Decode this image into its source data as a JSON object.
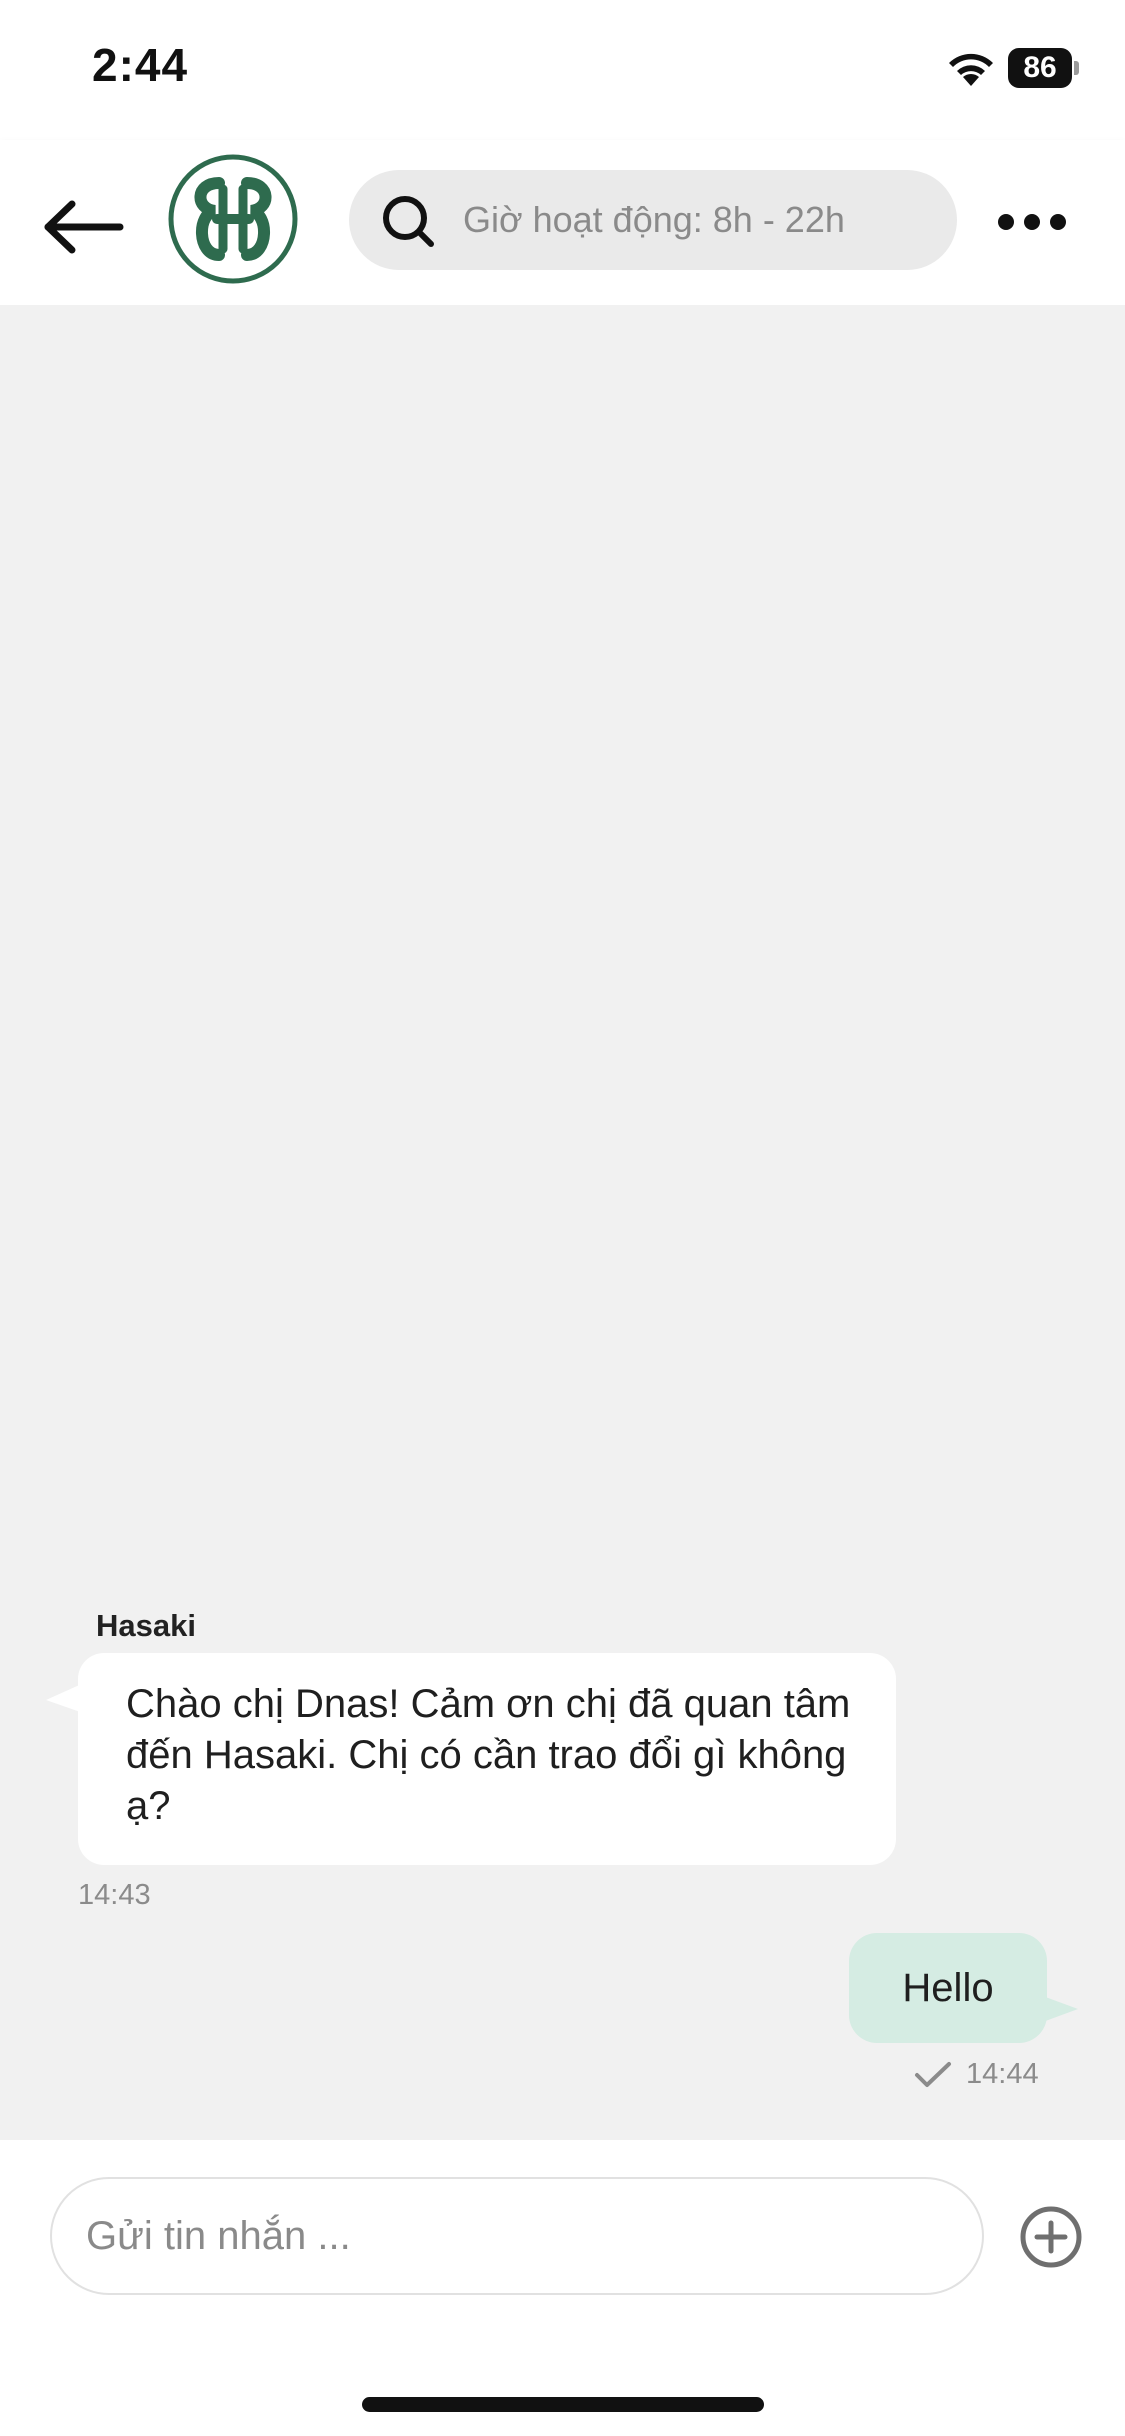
{
  "status_bar": {
    "time": "2:44",
    "battery": "86"
  },
  "header": {
    "search_placeholder": "Giờ hoạt động: 8h - 22h",
    "logo_icon": "hasaki-logo-icon",
    "brand_color": "#2e6b4e"
  },
  "chat": {
    "incoming": {
      "sender": "Hasaki",
      "text": "Chào chị Dnas! Cảm ơn chị đã quan tâm đến Hasaki. Chị có cần trao đổi gì không ạ?",
      "time": "14:43"
    },
    "outgoing": {
      "text": "Hello",
      "time": "14:44",
      "status_icon": "check-icon",
      "bubble_color": "#d5ece3"
    }
  },
  "composer": {
    "placeholder": "Gửi tin nhắn ..."
  }
}
